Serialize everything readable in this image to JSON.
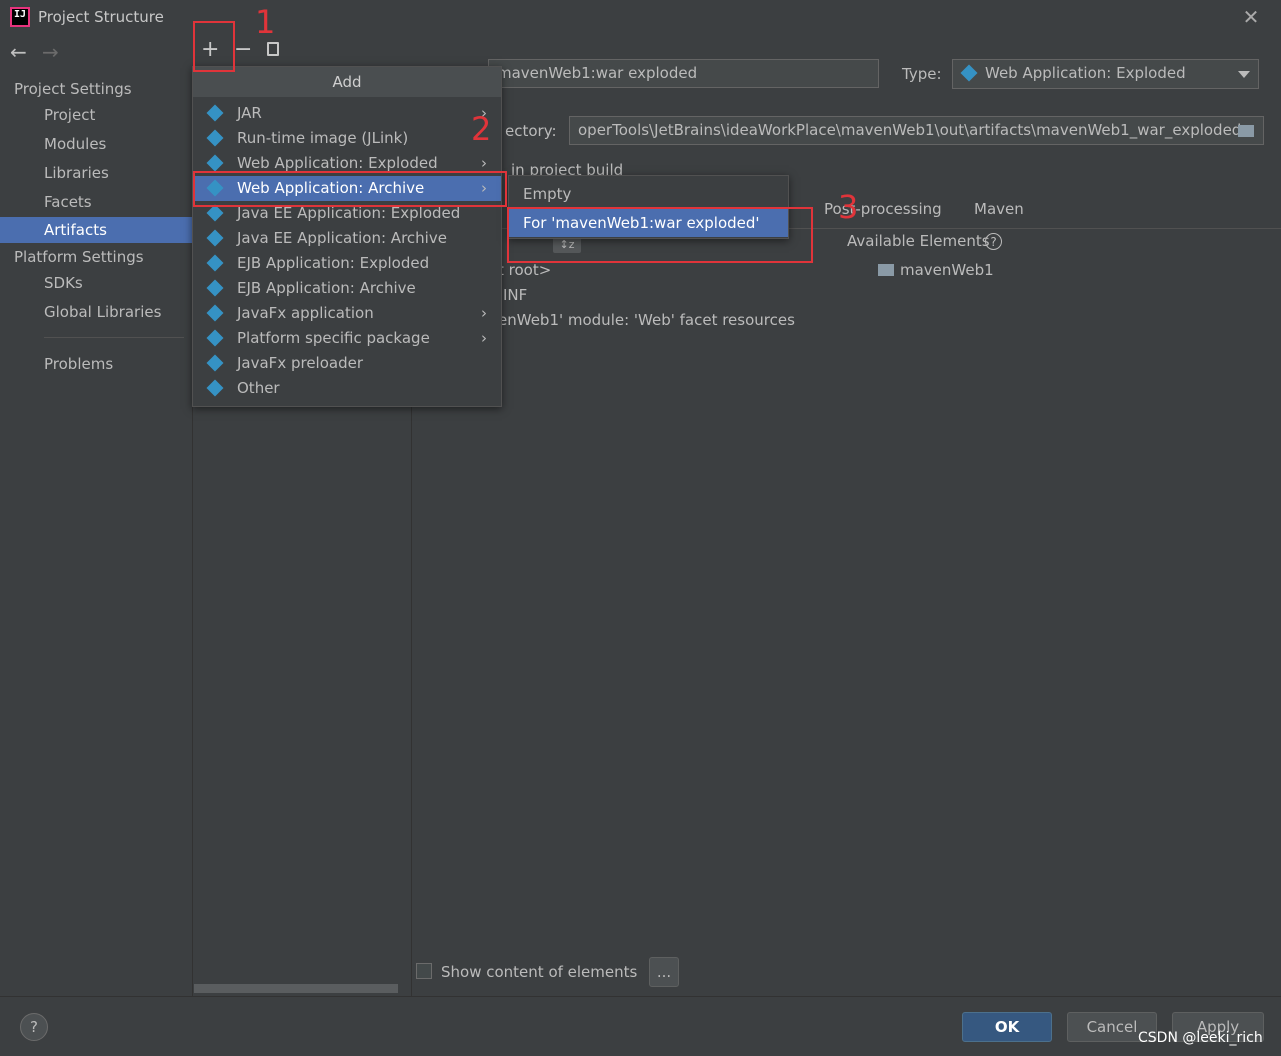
{
  "window": {
    "title": "Project Structure"
  },
  "sidebar": {
    "project_settings_heading": "Project Settings",
    "project_items": [
      "Project",
      "Modules",
      "Libraries",
      "Facets",
      "Artifacts"
    ],
    "selected_item": "Artifacts",
    "platform_settings_heading": "Platform Settings",
    "platform_items": [
      "SDKs",
      "Global Libraries"
    ],
    "problems": "Problems"
  },
  "artifact": {
    "name_value": "mavenWeb1:war exploded",
    "type_label": "Type:",
    "type_value": "Web Application: Exploded",
    "output_dir_label": "ectory:",
    "output_dir_value": "operTools\\JetBrains\\ideaWorkPlace\\mavenWeb1\\out\\artifacts\\mavenWeb1_war_exploded",
    "include_build_text": "in project build",
    "tabs": [
      "Post-processing",
      "Maven"
    ],
    "available_elements_label": "Available Elements",
    "available_tree_item": "mavenWeb1",
    "layout_tree": [
      "t root>",
      "INF",
      "enWeb1' module: 'Web' facet resources"
    ],
    "show_content_label": "Show content of elements",
    "ellipsis_button": "..."
  },
  "add_menu": {
    "header": "Add",
    "items": [
      {
        "label": "JAR",
        "submenu": true
      },
      {
        "label": "Run-time image (JLink)",
        "submenu": false
      },
      {
        "label": "Web Application: Exploded",
        "submenu": true
      },
      {
        "label": "Web Application: Archive",
        "submenu": true
      },
      {
        "label": "Java EE Application: Exploded",
        "submenu": false
      },
      {
        "label": "Java EE Application: Archive",
        "submenu": false
      },
      {
        "label": "EJB Application: Exploded",
        "submenu": false
      },
      {
        "label": "EJB Application: Archive",
        "submenu": false
      },
      {
        "label": "JavaFx application",
        "submenu": true
      },
      {
        "label": "Platform specific package",
        "submenu": true
      },
      {
        "label": "JavaFx preloader",
        "submenu": false
      },
      {
        "label": "Other",
        "submenu": false
      }
    ],
    "selected_index": 3
  },
  "submenu": {
    "items": [
      "Empty",
      "For 'mavenWeb1:war exploded'"
    ],
    "selected_index": 1
  },
  "annotations": {
    "step1": "1",
    "step2": "2",
    "step3": "3"
  },
  "buttons": {
    "ok": "OK",
    "cancel": "Cancel",
    "apply": "Apply",
    "help": "?"
  },
  "watermark": "CSDN @leeki_rich",
  "icons": {
    "back": "arrow-left-icon",
    "forward": "arrow-right-icon",
    "add": "plus-icon",
    "remove": "minus-icon",
    "copy": "copy-icon",
    "close": "close-icon",
    "folder": "folder-icon",
    "help": "help-icon"
  },
  "colors": {
    "selection": "#4b6eaf",
    "annotation": "#e0343a",
    "background": "#3c3f41"
  }
}
